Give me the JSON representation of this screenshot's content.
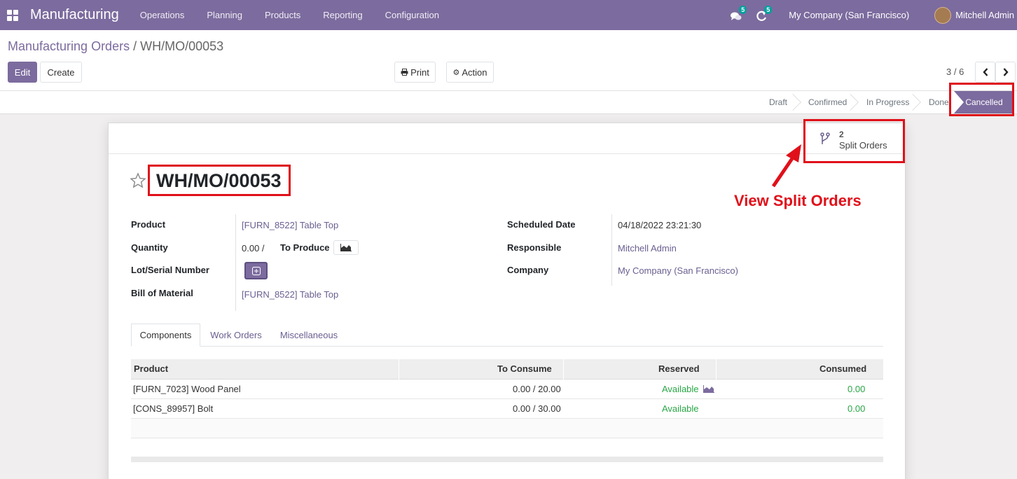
{
  "navbar": {
    "app_name": "Manufacturing",
    "menu": [
      "Operations",
      "Planning",
      "Products",
      "Reporting",
      "Configuration"
    ],
    "messages_badge": "5",
    "activities_badge": "5",
    "company": "My Company (San Francisco)",
    "user": "Mitchell Admin"
  },
  "breadcrumb": {
    "parent": "Manufacturing Orders",
    "separator": " / ",
    "current": "WH/MO/00053"
  },
  "buttons": {
    "edit": "Edit",
    "create": "Create",
    "print": "Print",
    "action": "Action"
  },
  "pager": "3 / 6",
  "statusbar": {
    "stages": [
      "Draft",
      "Confirmed",
      "In Progress",
      "Done"
    ],
    "active": "Cancelled"
  },
  "smart_button": {
    "count": "2",
    "label": "Split Orders"
  },
  "record": {
    "name": "WH/MO/00053",
    "left_fields": [
      {
        "label": "Product",
        "value": "[FURN_8522] Table Top"
      },
      {
        "label": "Quantity",
        "value": "0.00 /",
        "extra": "To Produce"
      },
      {
        "label": "Lot/Serial Number",
        "value": ""
      },
      {
        "label": "Bill of Material",
        "value": "[FURN_8522] Table Top"
      }
    ],
    "right_fields": [
      {
        "label": "Scheduled Date",
        "value": "04/18/2022 23:21:30"
      },
      {
        "label": "Responsible",
        "value": "Mitchell Admin"
      },
      {
        "label": "Company",
        "value": "My Company (San Francisco)"
      }
    ]
  },
  "tabs": [
    "Components",
    "Work Orders",
    "Miscellaneous"
  ],
  "table": {
    "headers": [
      "Product",
      "To Consume",
      "Reserved",
      "Consumed"
    ],
    "rows": [
      {
        "product": "[FURN_7023] Wood Panel",
        "to_consume": "0.00 / 20.00",
        "reserved": "Available",
        "consumed": "0.00"
      },
      {
        "product": "[CONS_89957] Bolt",
        "to_consume": "0.00 / 30.00",
        "reserved": "Available",
        "consumed": "0.00"
      }
    ]
  },
  "annotation": "View Split Orders",
  "colors": {
    "brand": "#7c6b9e",
    "annotation_red": "#e0101a",
    "available_green": "#28a745"
  }
}
